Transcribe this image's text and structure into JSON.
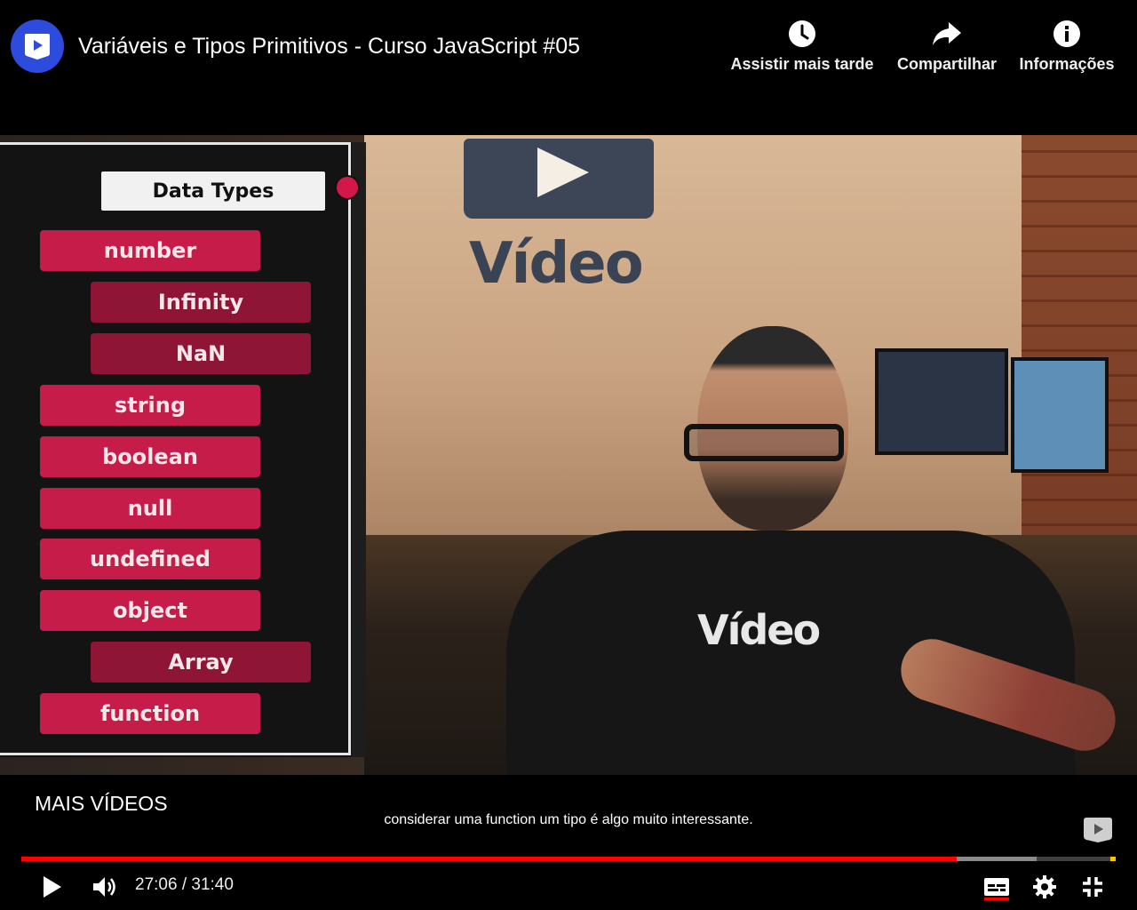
{
  "header": {
    "title": "Variáveis e Tipos Primitivos - Curso JavaScript #05",
    "channel_logo": "curso-em-video-logo-icon",
    "actions": [
      {
        "label": "Assistir mais tarde",
        "icon": "clock-icon"
      },
      {
        "label": "Compartilhar",
        "icon": "share-arrow-icon"
      },
      {
        "label": "Informações",
        "icon": "info-icon"
      }
    ]
  },
  "video_overlay": {
    "header": "Data Types",
    "items": [
      {
        "label": "number",
        "level": "primary"
      },
      {
        "label": "Infinity",
        "level": "sub"
      },
      {
        "label": "NaN",
        "level": "sub"
      },
      {
        "label": "string",
        "level": "primary"
      },
      {
        "label": "boolean",
        "level": "primary"
      },
      {
        "label": "null",
        "level": "primary"
      },
      {
        "label": "undefined",
        "level": "primary"
      },
      {
        "label": "object",
        "level": "primary"
      },
      {
        "label": "Array",
        "level": "sub"
      },
      {
        "label": "function",
        "level": "primary"
      }
    ],
    "scene_brand_text": "Vídeo",
    "shirt_text": "Vídeo"
  },
  "bottom": {
    "more_videos": "MAIS VÍDEOS",
    "caption": "considerar uma function um tipo é algo muito interessante.",
    "time_current": "27:06",
    "time_total": "31:40",
    "time_display": "27:06 / 31:40",
    "played_fraction": 0.855,
    "buffered_fraction": 0.928
  },
  "controls": {
    "play": "play-icon",
    "volume": "volume-icon",
    "captions": "subtitles-icon",
    "settings": "gear-icon",
    "fullscreen_exit": "exit-fullscreen-icon"
  },
  "colors": {
    "accent_red": "#ff0000",
    "chip_primary": "#c61c4a",
    "chip_sub": "#8f1537",
    "channel_blue": "#2d4bdc"
  }
}
